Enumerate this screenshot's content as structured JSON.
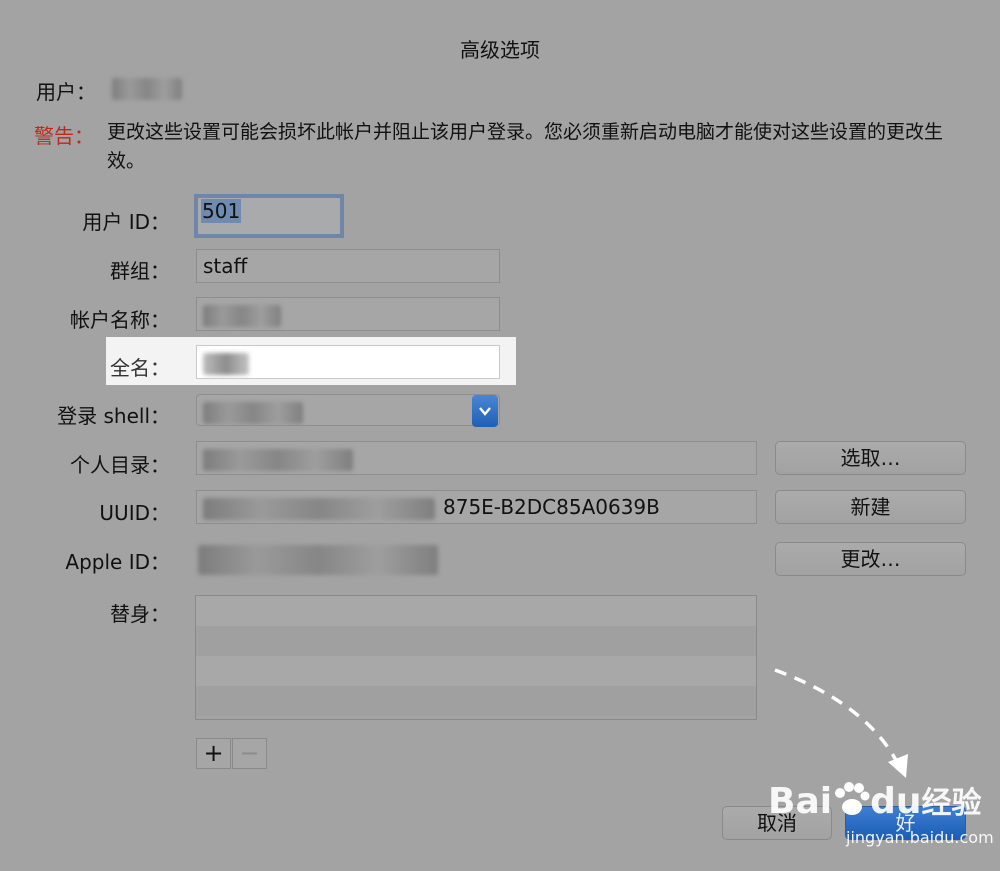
{
  "dialog": {
    "title": "高级选项",
    "user_label": "用户：",
    "warning_label": "警告：",
    "warning_text": "更改这些设置可能会损坏此帐户并阻止该用户登录。您必须重新启动电脑才能使对这些设置的更改生效。"
  },
  "fields": {
    "user_id": {
      "label": "用户 ID：",
      "value": "501"
    },
    "group": {
      "label": "群组：",
      "value": "staff"
    },
    "account_name": {
      "label": "帐户名称："
    },
    "full_name": {
      "label": "全名："
    },
    "login_shell": {
      "label": "登录 shell："
    },
    "home_dir": {
      "label": "个人目录："
    },
    "uuid": {
      "label": "UUID：",
      "value_visible_suffix": "875E-B2DC85A0639B"
    },
    "apple_id": {
      "label": "Apple ID："
    },
    "aliases": {
      "label": "替身："
    }
  },
  "buttons": {
    "choose": "选取…",
    "new": "新建",
    "change": "更改…",
    "cancel": "取消",
    "ok": "好"
  },
  "list_controls": {
    "add": "+",
    "remove": "−"
  },
  "watermark": {
    "brand": "Bai",
    "brand2": "du",
    "product": "经验",
    "url": "jingyan.baidu.com"
  },
  "colors": {
    "background": "#a3a3a3",
    "warning": "#c0281e",
    "accent": "#1c5db6"
  }
}
